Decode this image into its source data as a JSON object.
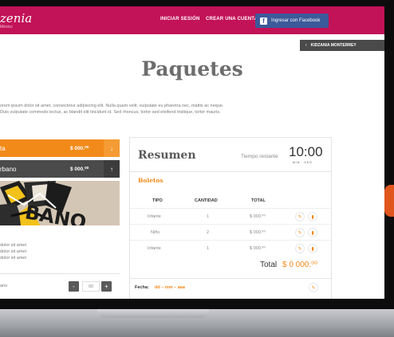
{
  "header": {
    "logo": "zenia",
    "logo_sub": "México",
    "nav": {
      "login": "INICIAR SESIÓN",
      "signup": "CREAR UNA CUENTA",
      "facebook": "Ingresar con Facebook"
    },
    "colors": {
      "brand": "#c21258",
      "facebook": "#3b5a9a"
    }
  },
  "city_tag": "KIDZANIA MONTERREY",
  "page_title": "Paquetes",
  "intro": {
    "line1": "orem ipsum dolor sit amet, consectetur adipiscing elit. Nulla quam velit, vulputate eu pharetra nec, mattis ac neque.",
    "line2": "Duis vulputate commodo lectus, ac blandit elit tincidunt id. Sed rhoncus, tortor sed eleifend tristique, tortor mauris."
  },
  "packages": [
    {
      "name": "ta",
      "price": "$ 000.⁰⁰",
      "arrow": "↓"
    },
    {
      "name": "rbano",
      "price": "$ 000.⁰⁰",
      "arrow": "↑"
    }
  ],
  "package_details": {
    "image_text": "BANO",
    "items": [
      "dolor sit amet",
      "dolor sit amet",
      "dolor sit amet"
    ],
    "qty_label": "ano",
    "qty_minus": "-",
    "qty_value": "00",
    "qty_plus": "+"
  },
  "summary": {
    "title": "Resumen",
    "timer_label": "Tiempo restante",
    "timer": "10:00",
    "timer_min": "MIN",
    "timer_sec": "SEG",
    "section": "Boletos",
    "columns": [
      "TIPO",
      "CANTIDAD",
      "TOTAL"
    ],
    "rows": [
      {
        "tipo": "Infante",
        "cantidad": "1",
        "total": "$ 000.⁰⁰"
      },
      {
        "tipo": "Niño",
        "cantidad": "2",
        "total": "$ 000.⁰⁰"
      },
      {
        "tipo": "Infante",
        "cantidad": "1",
        "total": "$ 000.⁰⁰"
      }
    ],
    "total_label": "Total",
    "total_value": "$ 0 000.⁰⁰",
    "fecha_label": "Fecha:",
    "fecha_value": "dd – mm – aaa",
    "accent": "#f28a1a"
  }
}
